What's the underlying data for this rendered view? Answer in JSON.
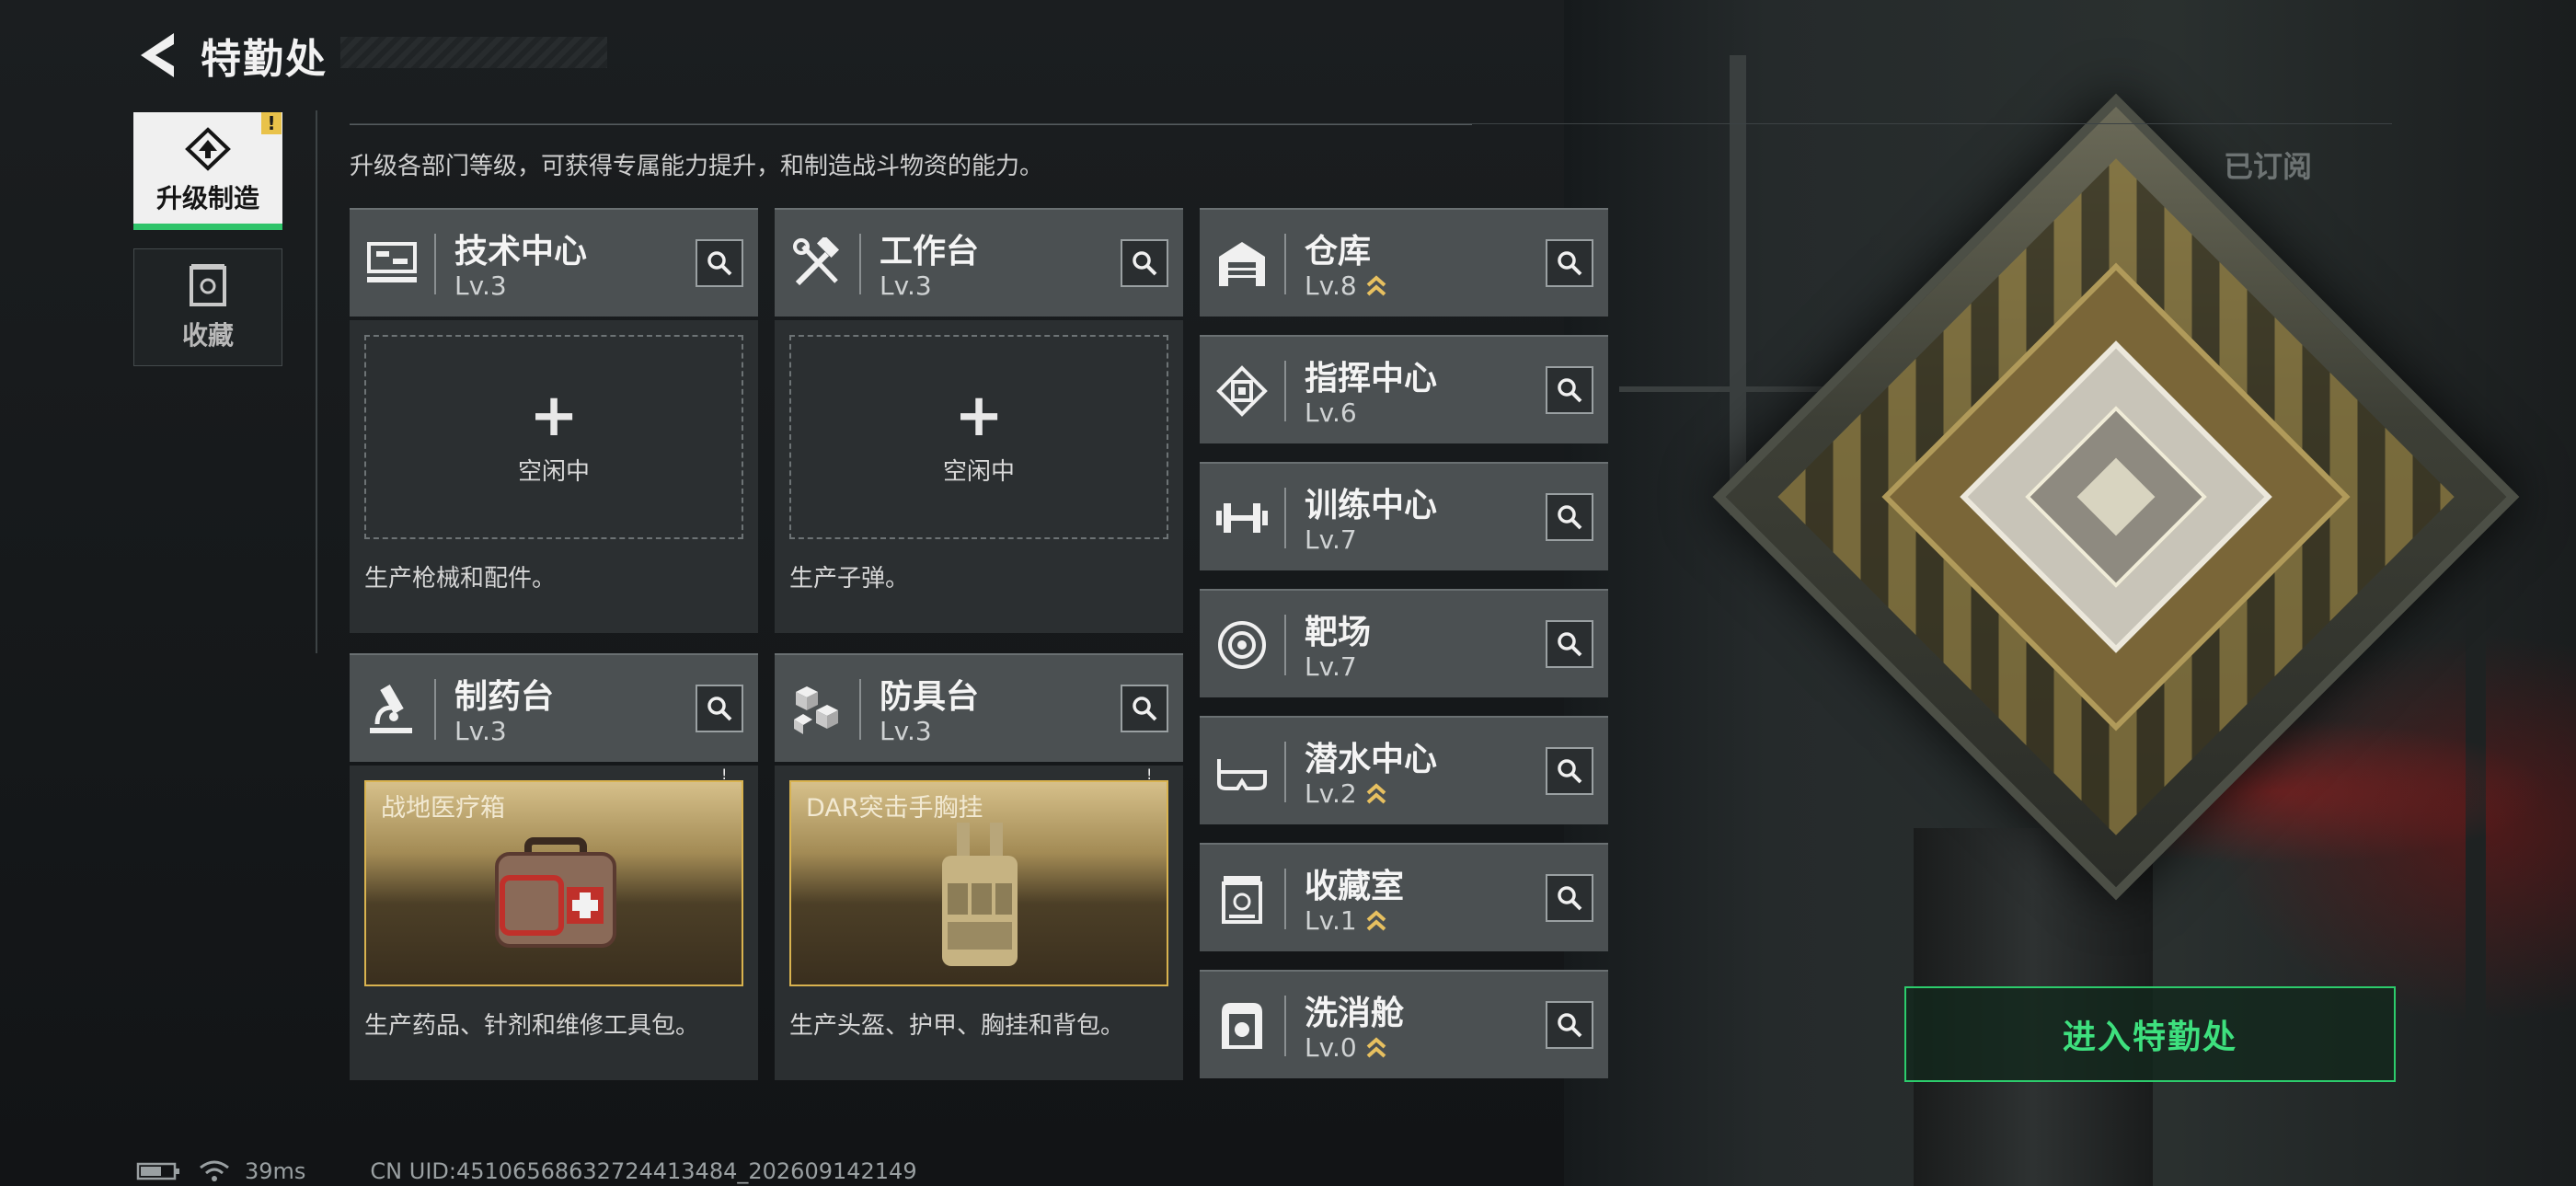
{
  "header": {
    "title": "特勤处"
  },
  "tabs": [
    {
      "label": "升级制造",
      "icon": "upgrade-icon",
      "active": true,
      "alert": "!"
    },
    {
      "label": "收藏",
      "icon": "collection-icon",
      "active": false
    }
  ],
  "subtitle": "升级各部门等级，可获得专属能力提升，和制造战斗物资的能力。",
  "subscribed_label": "已订阅",
  "production_cards": [
    {
      "name": "技术中心",
      "level": "Lv.3",
      "icon": "computer-icon",
      "slot_plus": "+",
      "slot_status": "空闲中",
      "description": "生产枪械和配件。"
    },
    {
      "name": "工作台",
      "level": "Lv.3",
      "icon": "tools-icon",
      "slot_plus": "+",
      "slot_status": "空闲中",
      "description": "生产子弹。"
    },
    {
      "name": "制药台",
      "level": "Lv.3",
      "icon": "microscope-icon",
      "product_name": "战地医疗箱",
      "product_alert": "!",
      "description": "生产药品、针剂和维修工具包。"
    },
    {
      "name": "防具台",
      "level": "Lv.3",
      "icon": "armor-blocks-icon",
      "product_name": "DAR突击手胸挂",
      "product_alert": "!",
      "description": "生产头盔、护甲、胸挂和背包。"
    }
  ],
  "facilities": [
    {
      "name": "仓库",
      "level": "Lv.8",
      "icon": "warehouse-icon",
      "upgradable": true
    },
    {
      "name": "指挥中心",
      "level": "Lv.6",
      "icon": "chip-icon",
      "upgradable": false
    },
    {
      "name": "训练中心",
      "level": "Lv.7",
      "icon": "dumbbell-icon",
      "upgradable": false
    },
    {
      "name": "靶场",
      "level": "Lv.7",
      "icon": "target-icon",
      "upgradable": false
    },
    {
      "name": "潜水中心",
      "level": "Lv.2",
      "icon": "diving-mask-icon",
      "upgradable": true
    },
    {
      "name": "收藏室",
      "level": "Lv.1",
      "icon": "vault-icon",
      "upgradable": true
    },
    {
      "name": "洗消舱",
      "level": "Lv.0",
      "icon": "decontamination-icon",
      "upgradable": true
    }
  ],
  "enter_button": "进入特勤处",
  "status_bar": {
    "ping": "39ms",
    "uid": "CN UID:4510656863272441348​4_202609142149"
  },
  "colors": {
    "accent_green": "#2fc46a",
    "alert_yellow": "#e9c24a",
    "upgrade_chevron": "#e7c060"
  }
}
